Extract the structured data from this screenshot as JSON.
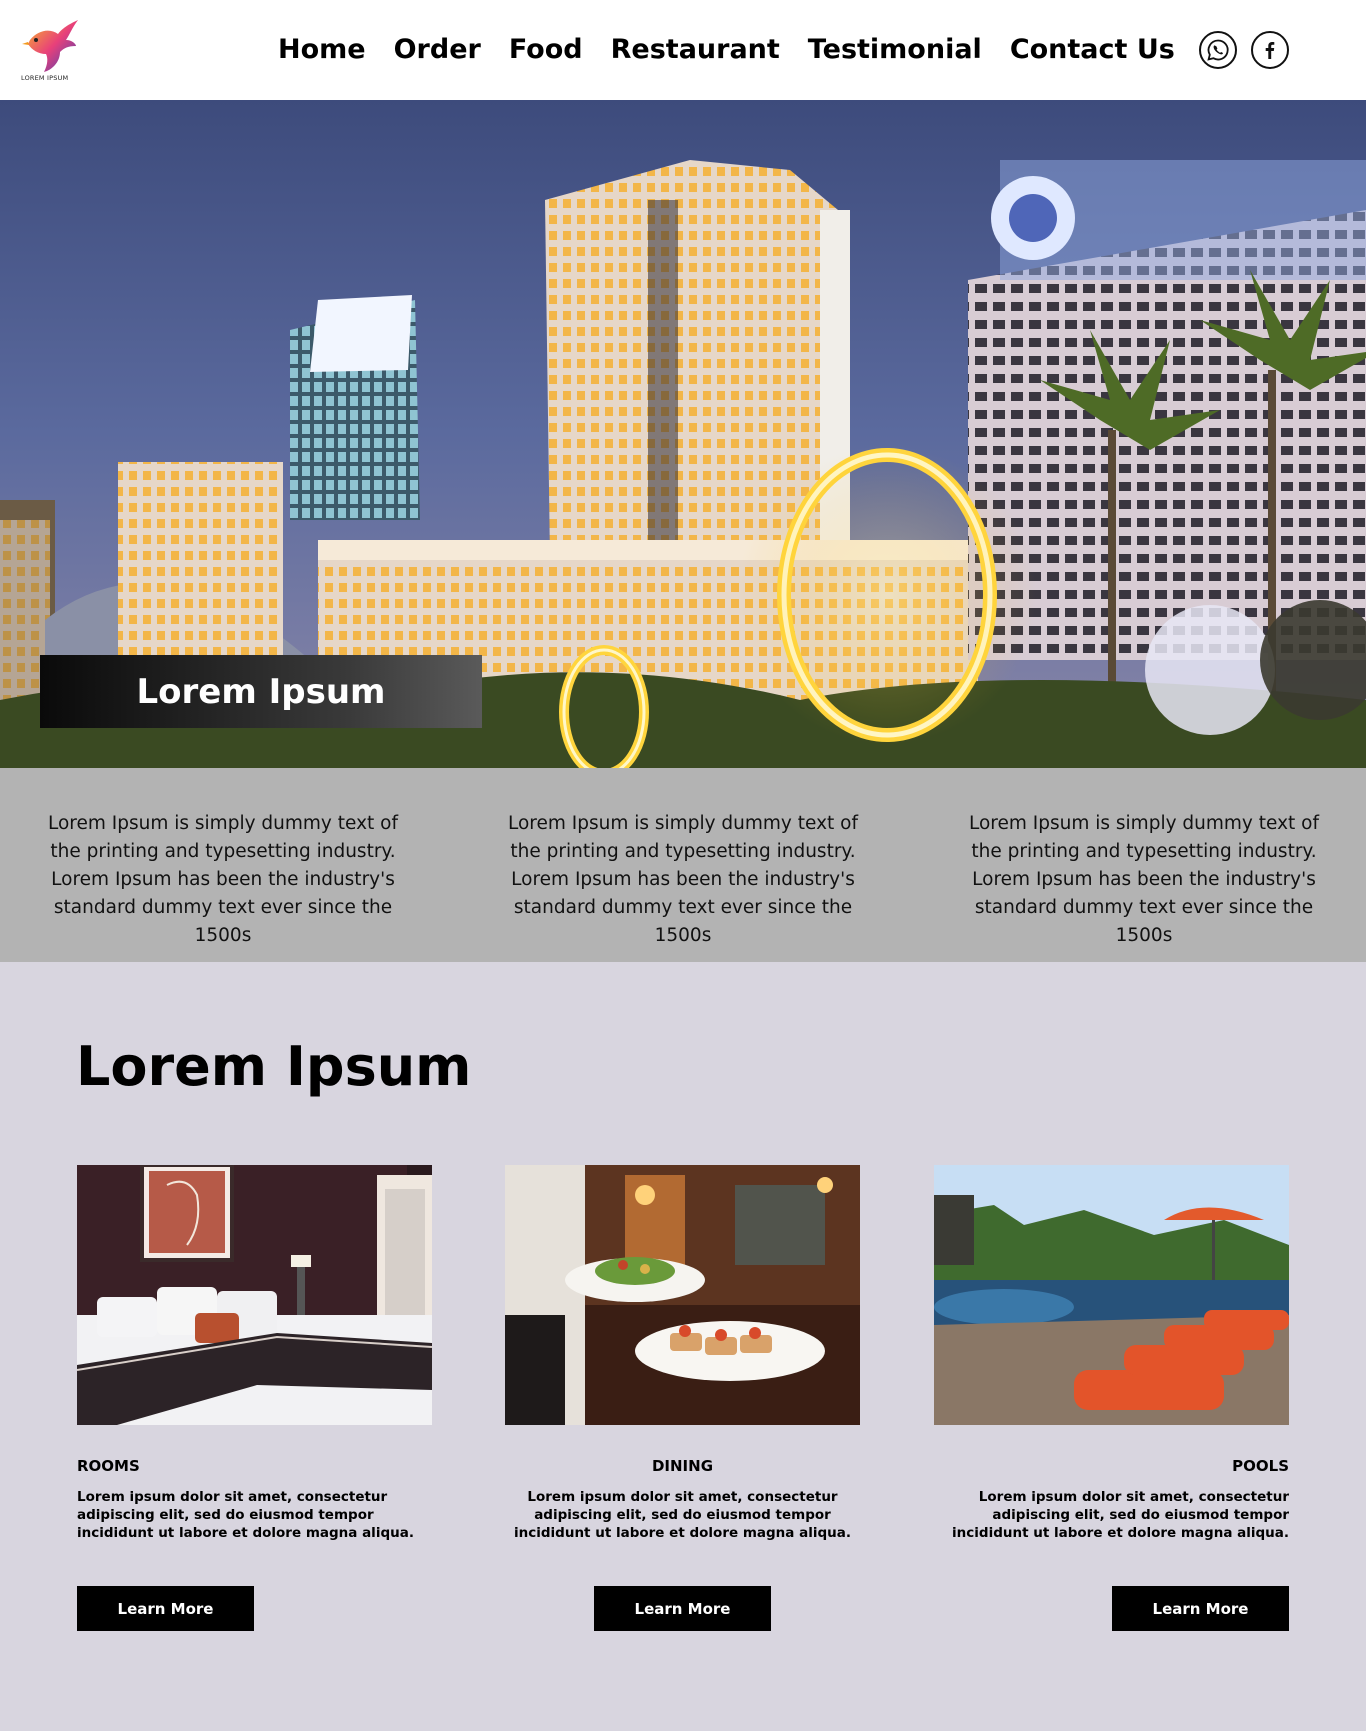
{
  "header": {
    "logo_text": "LOREM IPSUM",
    "nav": [
      "Home",
      "Order",
      "Food",
      "Restaurant",
      "Testimonial",
      "Contact Us"
    ],
    "social": [
      "whatsapp-icon",
      "facebook-icon"
    ]
  },
  "hero": {
    "banner_text": "Lorem Ipsum"
  },
  "strip": {
    "columns": [
      "Lorem Ipsum is simply dummy text of the printing and typesetting industry. Lorem Ipsum has been the industry's standard dummy text ever since the 1500s",
      "Lorem Ipsum is simply dummy text of the printing and typesetting industry. Lorem Ipsum has been the industry's standard dummy text ever since the 1500s",
      "Lorem Ipsum is simply dummy text of the printing and typesetting industry. Lorem Ipsum has been the industry's standard dummy text ever since the 1500s"
    ]
  },
  "section": {
    "title": "Lorem Ipsum",
    "cards": [
      {
        "title": "ROOMS",
        "desc": "Lorem ipsum dolor sit amet, consectetur adipiscing elit, sed do eiusmod tempor incididunt ut labore et dolore magna aliqua.",
        "button": "Learn More"
      },
      {
        "title": "DINING",
        "desc": "Lorem ipsum dolor sit amet, consectetur adipiscing elit, sed do eiusmod tempor incididunt ut labore et dolore magna aliqua.",
        "button": "Learn More"
      },
      {
        "title": "POOLS",
        "desc": "Lorem ipsum dolor sit amet, consectetur adipiscing elit, sed do eiusmod tempor incididunt ut labore et dolore magna aliqua.",
        "button": "Learn More"
      }
    ]
  },
  "colors": {
    "header_bg": "#ffffff",
    "strip_bg": "#b3b3b3",
    "section_bg": "#d8d5df",
    "button_bg": "#000000"
  }
}
